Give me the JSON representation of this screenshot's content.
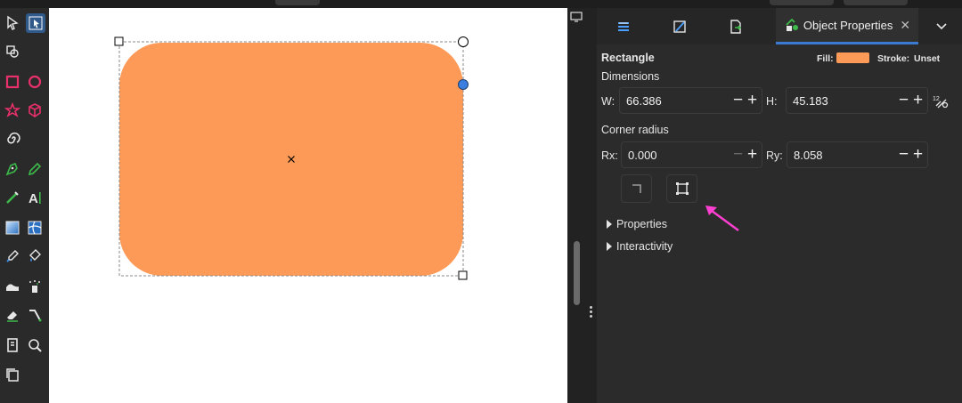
{
  "panel": {
    "active_tab_label": "Object Properties",
    "object_type": "Rectangle",
    "fill_label": "Fill:",
    "fill_color": "#fe9a57",
    "stroke_label": "Stroke:",
    "stroke_value": "Unset",
    "dimensions_label": "Dimensions",
    "w_label": "W:",
    "w_value": "66.386",
    "h_label": "H:",
    "h_value": "45.183",
    "corner_radius_label": "Corner radius",
    "rx_label": "Rx:",
    "rx_value": "0.000",
    "ry_label": "Ry:",
    "ry_value": "8.058",
    "expanders": [
      "Properties",
      "Interactivity"
    ]
  },
  "colors": {
    "shape_fill": "#fe9a57",
    "accent": "#3b7ad1",
    "arrow": "#ff3fd0"
  }
}
